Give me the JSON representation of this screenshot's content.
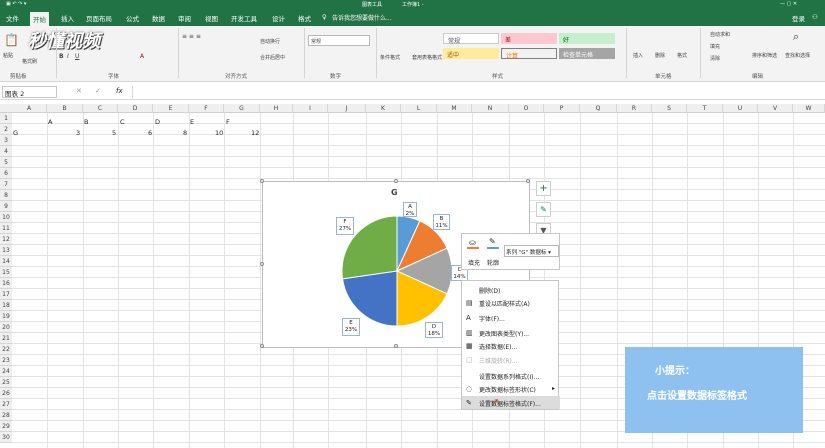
{
  "title": {
    "center": "工作簿1 -",
    "context": "图表工具",
    "login": "登录"
  },
  "tabs": [
    "文件",
    "开始",
    "插入",
    "页面布局",
    "公式",
    "数据",
    "审阅",
    "视图",
    "开发工具",
    "设计",
    "格式"
  ],
  "search_hint": "告诉我您想要做什么...",
  "watermark": "秒懂视频",
  "ribbon": {
    "groups": [
      "剪贴板",
      "字体",
      "对齐方式",
      "数字",
      "样式",
      "单元格",
      "编辑"
    ],
    "paste": "粘贴",
    "format_painter": "格式刷",
    "wrap": "自动换行",
    "merge": "合并后居中",
    "number_format": "常规",
    "cond_format": "条件格式",
    "table_format": "套用表格格式",
    "styles": [
      "常规",
      "差",
      "好",
      "适中",
      "计算",
      "检查单元格"
    ],
    "insert": "插入",
    "delete": "删除",
    "format": "格式",
    "autosum": "自动求和",
    "fill": "填充",
    "clear": "清除",
    "sort_filter": "排序和筛选",
    "find_select": "查找和选择"
  },
  "formula_bar": {
    "name_box": "图表 2",
    "fx": "fx"
  },
  "columns": [
    "A",
    "B",
    "C",
    "D",
    "E",
    "F",
    "G",
    "H",
    "I",
    "J",
    "K",
    "L",
    "M",
    "N",
    "O",
    "P",
    "Q",
    "R",
    "S",
    "T",
    "U",
    "V",
    "W"
  ],
  "rows": [
    "1",
    "2",
    "3",
    "4",
    "5",
    "6",
    "7",
    "8",
    "9",
    "10",
    "11",
    "12",
    "13",
    "14",
    "15",
    "16",
    "17",
    "18",
    "19",
    "20",
    "21",
    "22",
    "23",
    "24",
    "25",
    "26",
    "27",
    "28",
    "29",
    "30"
  ],
  "sheet": {
    "row1": [
      "A",
      "B",
      "C",
      "D",
      "E",
      "F"
    ],
    "row2_label": "G",
    "row2_values": [
      "3",
      "5",
      "6",
      "8",
      "10",
      "12"
    ]
  },
  "chart_data": {
    "type": "pie",
    "title": "G",
    "categories": [
      "A",
      "B",
      "C",
      "D",
      "E",
      "F"
    ],
    "values": [
      3,
      5,
      6,
      8,
      10,
      12
    ],
    "labels": [
      "2%",
      "11%",
      "14%",
      "18%",
      "23%",
      "27%"
    ],
    "colors": [
      "#5b9bd5",
      "#ed7d31",
      "#a5a5a5",
      "#ffc000",
      "#4472c4",
      "#70ad47"
    ]
  },
  "mini_toolbar": {
    "fill": "填充",
    "outline": "轮廓",
    "series": "系列 \"G\" 数据标"
  },
  "context_menu": [
    {
      "label": "删除(D)",
      "icon": ""
    },
    {
      "label": "重设以匹配样式(A)",
      "icon": "▤"
    },
    {
      "label": "字体(F)...",
      "icon": "A"
    },
    {
      "label": "更改图表类型(Y)...",
      "icon": "▥"
    },
    {
      "label": "选择数据(E)...",
      "icon": "▦"
    },
    {
      "label": "三维旋转(R)...",
      "icon": "▢"
    },
    {
      "label": "设置数据系列格式(I)...",
      "icon": ""
    },
    {
      "label": "更改数据标签形状(C)",
      "icon": "◌"
    },
    {
      "label": "设置数据标签格式(F)...",
      "icon": "✎"
    }
  ],
  "tip": {
    "line1": "小提示：",
    "line2": "点击设置数据标签格式"
  }
}
